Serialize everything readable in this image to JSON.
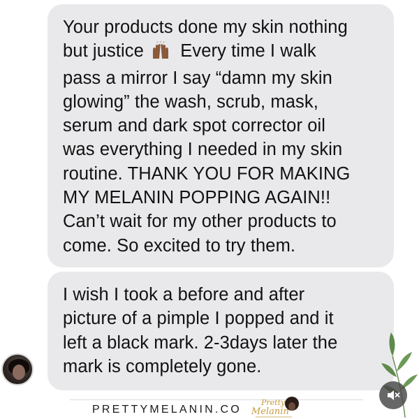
{
  "messages": [
    {
      "lines": [
        "Your products done my skin nothing",
        "but justice",
        "Every time I walk",
        "pass a mirror I say “damn my skin",
        "glowing” the wash, scrub, mask,",
        "serum and dark spot corrector oil",
        "was everything I needed in my skin",
        "routine. THANK YOU FOR MAKING",
        "MY MELANIN POPPING AGAIN!!",
        "Can’t wait for my other products to",
        "come. So excited to try them."
      ],
      "emoji": "raising-hands-emoji"
    },
    {
      "lines": [
        "I wish I took a before and after",
        "picture of a pimple I popped and it",
        "left a black mark. 2-3days later the",
        "mark is completely gone."
      ]
    }
  ],
  "footer": {
    "brand": "PRETTYMELANIN.CO",
    "logo_text": "Pretty Melanin"
  },
  "colors": {
    "bubble": "#e9e9eb",
    "text": "#111111",
    "leaf": "#5f8a4e"
  }
}
